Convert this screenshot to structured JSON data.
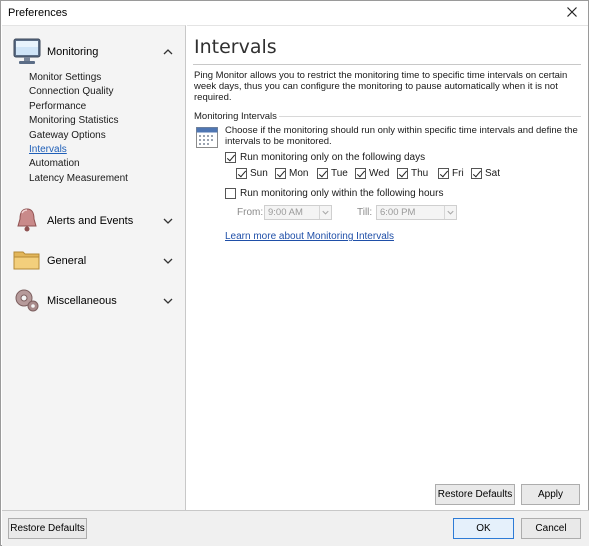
{
  "window": {
    "title": "Preferences"
  },
  "sidebar": {
    "groups": [
      {
        "label": "Monitoring",
        "icon": "monitor-icon",
        "expanded": true
      },
      {
        "label": "Alerts and Events",
        "icon": "bell-icon",
        "expanded": false
      },
      {
        "label": "General",
        "icon": "folder-icon",
        "expanded": false
      },
      {
        "label": "Miscellaneous",
        "icon": "gear-icon",
        "expanded": false
      }
    ],
    "items": [
      {
        "label": "Monitor Settings"
      },
      {
        "label": "Connection Quality"
      },
      {
        "label": "Performance"
      },
      {
        "label": "Monitoring Statistics"
      },
      {
        "label": "Gateway Options"
      },
      {
        "label": "Intervals",
        "active": true
      },
      {
        "label": "Automation"
      },
      {
        "label": "Latency Measurement"
      }
    ]
  },
  "main": {
    "title": "Intervals",
    "description": "Ping Monitor allows you to restrict the monitoring time to specific time intervals on certain week days, thus you can configure the monitoring to pause automatically when it is not required.",
    "section": {
      "title": "Monitoring Intervals",
      "description": "Choose if the monitoring should run only within specific time intervals and define the intervals to be monitored.",
      "run_days_label": "Run monitoring only on the following days",
      "run_days_checked": true,
      "days": [
        {
          "label": "Sun",
          "checked": true
        },
        {
          "label": "Mon",
          "checked": true
        },
        {
          "label": "Tue",
          "checked": true
        },
        {
          "label": "Wed",
          "checked": true
        },
        {
          "label": "Thu",
          "checked": true
        },
        {
          "label": "Fri",
          "checked": true
        },
        {
          "label": "Sat",
          "checked": true
        }
      ],
      "run_hours_label": "Run monitoring only within the following hours",
      "run_hours_checked": false,
      "from_label": "From:",
      "from_value": "9:00 AM",
      "till_label": "Till:",
      "till_value": "6:00 PM",
      "learn_more": "Learn more about Monitoring Intervals"
    },
    "buttons": {
      "restore": "Restore Defaults",
      "apply": "Apply"
    }
  },
  "footer": {
    "restore": "Restore Defaults",
    "ok": "OK",
    "cancel": "Cancel"
  },
  "colors": {
    "accent": "#1f5fb8",
    "link": "#1f4fa8",
    "sidebar_bg": "#f4f4f4",
    "primary_border": "#2d7bd6"
  }
}
